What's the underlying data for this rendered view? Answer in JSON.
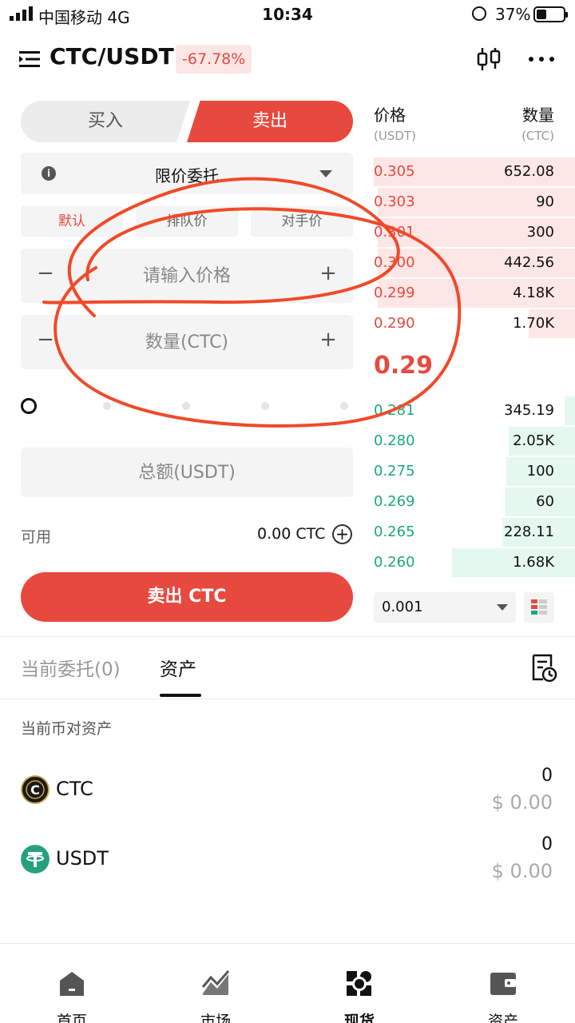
{
  "status": {
    "carrier": "中国移动   4G",
    "time": "10:34",
    "battery": "37%"
  },
  "header": {
    "pair": "CTC/USDT",
    "change": "-67.78%"
  },
  "trade": {
    "buy_label": "买入",
    "sell_label": "卖出",
    "order_type": "限价委托",
    "price_options": [
      "默认",
      "排队价",
      "对手价"
    ],
    "price_placeholder": "请输入价格",
    "qty_placeholder": "数量(CTC)",
    "total_placeholder": "总额(USDT)",
    "available_label": "可用",
    "available_value": "0.00 CTC",
    "submit_label": "卖出 CTC",
    "slider_percent": 0
  },
  "orderbook": {
    "price_header": "价格",
    "price_unit": "(USDT)",
    "qty_header": "数量",
    "qty_unit": "(CTC)",
    "asks": [
      {
        "price": "0.305",
        "qty": "652.08",
        "depth": 1.0
      },
      {
        "price": "0.303",
        "qty": "90",
        "depth": 0.98
      },
      {
        "price": "0.301",
        "qty": "300",
        "depth": 0.98
      },
      {
        "price": "0.300",
        "qty": "442.56",
        "depth": 0.98
      },
      {
        "price": "0.299",
        "qty": "4.18K",
        "depth": 0.98
      },
      {
        "price": "0.290",
        "qty": "1.70K",
        "depth": 0.23
      }
    ],
    "last_price": "0.29",
    "bids": [
      {
        "price": "0.281",
        "qty": "345.19",
        "depth": 0.05
      },
      {
        "price": "0.280",
        "qty": "2.05K",
        "depth": 0.33
      },
      {
        "price": "0.275",
        "qty": "100",
        "depth": 0.34
      },
      {
        "price": "0.269",
        "qty": "60",
        "depth": 0.35
      },
      {
        "price": "0.265",
        "qty": "228.11",
        "depth": 0.36
      },
      {
        "price": "0.260",
        "qty": "1.68K",
        "depth": 0.61
      }
    ],
    "depth_value": "0.001"
  },
  "tabs": {
    "orders": "当前委托(0)",
    "assets": "资产"
  },
  "assets": {
    "section_label": "当前币对资产",
    "items": [
      {
        "name": "CTC",
        "amount": "0",
        "usd": "$ 0.00"
      },
      {
        "name": "USDT",
        "amount": "0",
        "usd": "$ 0.00"
      }
    ]
  },
  "nav": [
    "首页",
    "市场",
    "现货",
    "资产"
  ],
  "colors": {
    "red": "#e8493f",
    "green": "#1aaa7a"
  }
}
